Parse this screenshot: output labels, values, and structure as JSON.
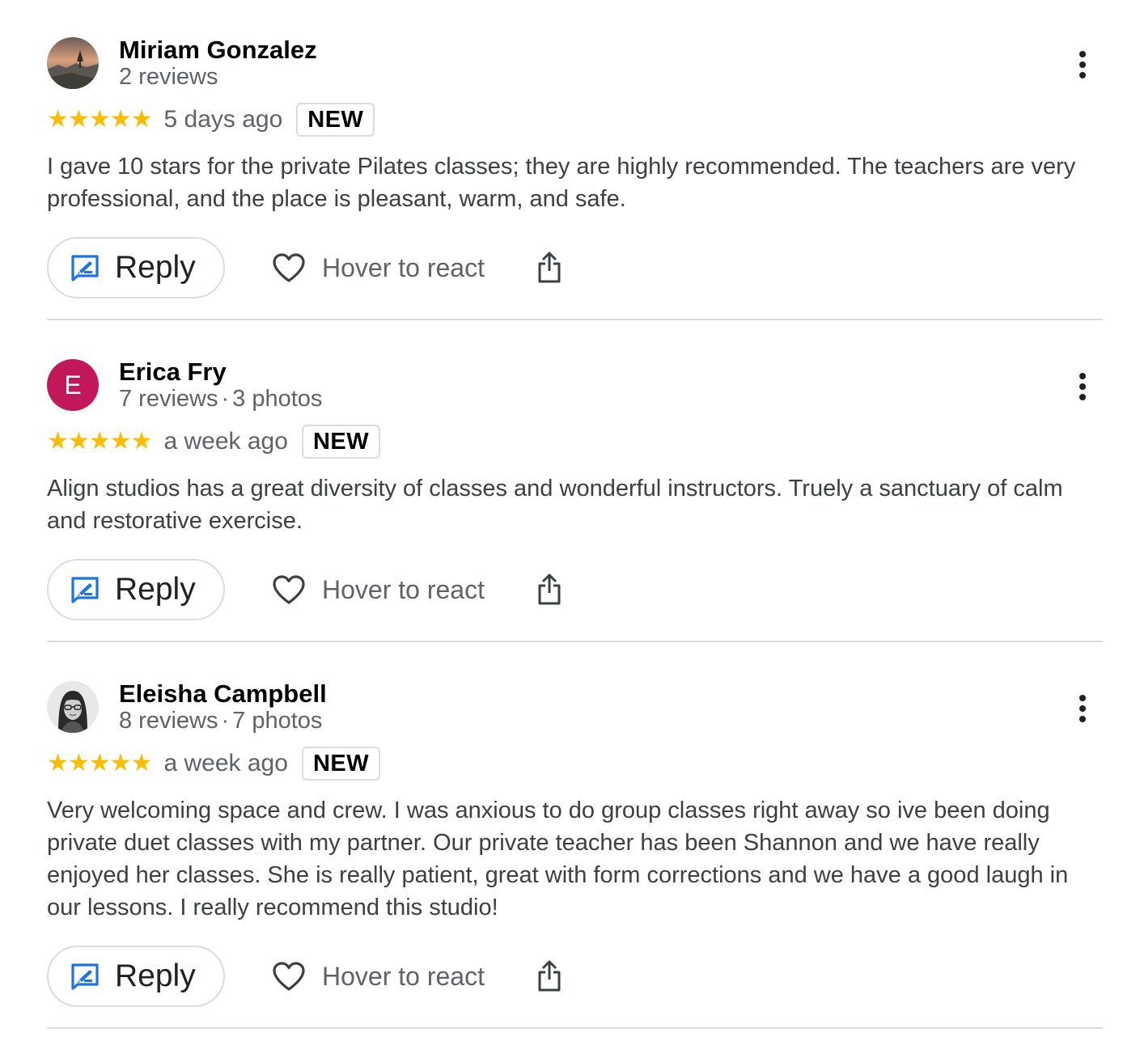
{
  "colors": {
    "star": "#fbbc04",
    "accent_blue": "#1a73e8",
    "avatar_letter_bg": "#c2185b"
  },
  "icons": {
    "reply": "reply-icon",
    "react": "heart-icon",
    "share": "share-icon",
    "more": "more-vert-icon",
    "star": "star-icon"
  },
  "actions": {
    "reply_label": "Reply",
    "react_label": "Hover to react"
  },
  "reviews": [
    {
      "author": "Miriam Gonzalez",
      "reviews_count": "2 reviews",
      "photos_count": "",
      "rating": 5,
      "stars": "★★★★★",
      "time_ago": "5 days ago",
      "badge": "NEW",
      "text": "I gave 10 stars for the private Pilates classes; they are highly recommended. The teachers are very professional, and the place is pleasant, warm, and safe.",
      "avatar": "landscape photo"
    },
    {
      "author": "Erica Fry",
      "reviews_count": "7 reviews",
      "photos_count": "3 photos",
      "rating": 5,
      "stars": "★★★★★",
      "time_ago": "a week ago",
      "badge": "NEW",
      "text": "Align studios has a great diversity of classes and wonderful instructors. Truely a sanctuary of calm and restorative exercise.",
      "avatar_letter": "E"
    },
    {
      "author": "Eleisha Campbell",
      "reviews_count": "8 reviews",
      "photos_count": "7 photos",
      "rating": 5,
      "stars": "★★★★★",
      "time_ago": "a week ago",
      "badge": "NEW",
      "text": "Very welcoming space and crew. I was anxious to do group classes right away so ive been doing private duet classes with my partner. Our private teacher has been Shannon and we have really enjoyed her classes. She is really patient, great with form corrections and we have a good laugh in our lessons. I really recommend this studio!",
      "avatar": "portrait photo"
    }
  ]
}
